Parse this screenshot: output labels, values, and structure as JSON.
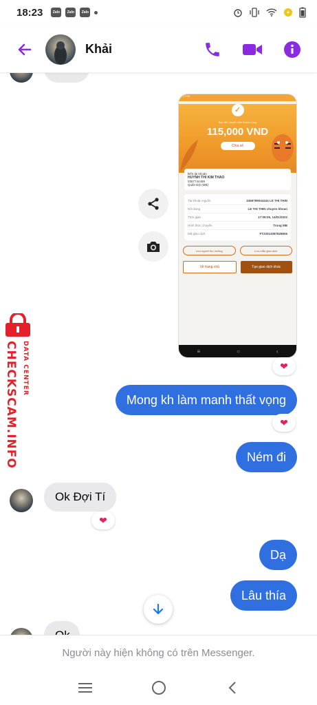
{
  "status_bar": {
    "time": "18:23",
    "app_badges": [
      "Zalo",
      "Zalo",
      "Zalo"
    ]
  },
  "header": {
    "contact_name": "Khải",
    "accent_color": "#8a2be2"
  },
  "transfer_screenshot": {
    "status_time": "17:09",
    "subtitle": "Bạn đã chuyển tiền thành công",
    "amount": "115,000 VND",
    "share_label": "Chia sẻ",
    "to_account_label": "Đến tài khoản",
    "recipient_name": "HUYNH THI KIM THAO",
    "recipient_account": "0357744459",
    "recipient_bank": "Quân Đội (MB)",
    "rows": [
      {
        "label": "Tài khoản nguồn",
        "value": "3456789044444 LE THI THIN"
      },
      {
        "label": "Nội dung",
        "value": "LE THI THIN chuyen khoan"
      },
      {
        "label": "Thời gian",
        "value": "17:09:05, 14/01/2022"
      },
      {
        "label": "Hình thức chuyển",
        "value": "Trong MB"
      },
      {
        "label": "Mã giao dịch",
        "value": "FT22014087828606"
      }
    ],
    "pill_save_recipient": "Lưu người thụ hưởng",
    "pill_save_template": "Lưu mẫu giao dịch",
    "btn_home": "Về trang chủ",
    "btn_new": "Tạo giao dịch khác"
  },
  "watermark": {
    "brand": "CHECKSCAM.INFO",
    "tag": "DATA CENTER"
  },
  "messages": {
    "out_1": "Mong kh làm manh thất vọng",
    "out_2": "Ném đi",
    "in_1": "Ok Đợi Tí",
    "out_3": "Dạ",
    "out_4": "Lâu thía",
    "in_partial": "Ok"
  },
  "reactions": {
    "heart": "❤"
  },
  "footer": {
    "notice": "Người này hiện không có trên Messenger."
  },
  "colors": {
    "outgoing_bubble": "#2f6fe0",
    "incoming_bubble": "#e9e9eb",
    "header_icons": "#8a2be2",
    "watermark": "#e4202a"
  }
}
